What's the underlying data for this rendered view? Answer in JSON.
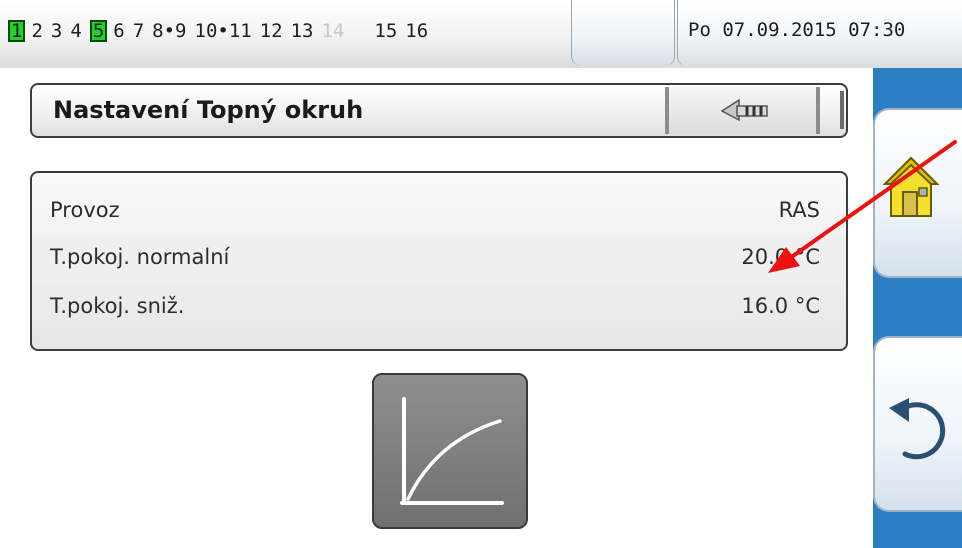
{
  "status_bar": {
    "channels": [
      "1",
      "2",
      "3",
      "4",
      "5",
      "6",
      "7",
      "8•9",
      "10•11",
      "12",
      "13",
      "14",
      "15",
      "16"
    ],
    "active_channels": [
      "1",
      "5"
    ],
    "datetime": "Po 07.09.2015 07:30"
  },
  "header": {
    "title": "Nastavení Topný okruh",
    "back_icon": "back-arrow-icon"
  },
  "settings": [
    {
      "label": "Provoz",
      "value": "RAS"
    },
    {
      "label": "T.pokoj. normalní",
      "value": "20.0 °C"
    },
    {
      "label": "T.pokoj. sniž.",
      "value": "16.0 °C"
    }
  ],
  "buttons": {
    "heating_curve_icon": "heating-curve-icon",
    "home_icon": "home-icon",
    "undo_icon": "undo-icon"
  },
  "colors": {
    "active_channel": "#22d02a",
    "sidebar": "#2d7fc4",
    "annotation_arrow": "#ee1111"
  }
}
